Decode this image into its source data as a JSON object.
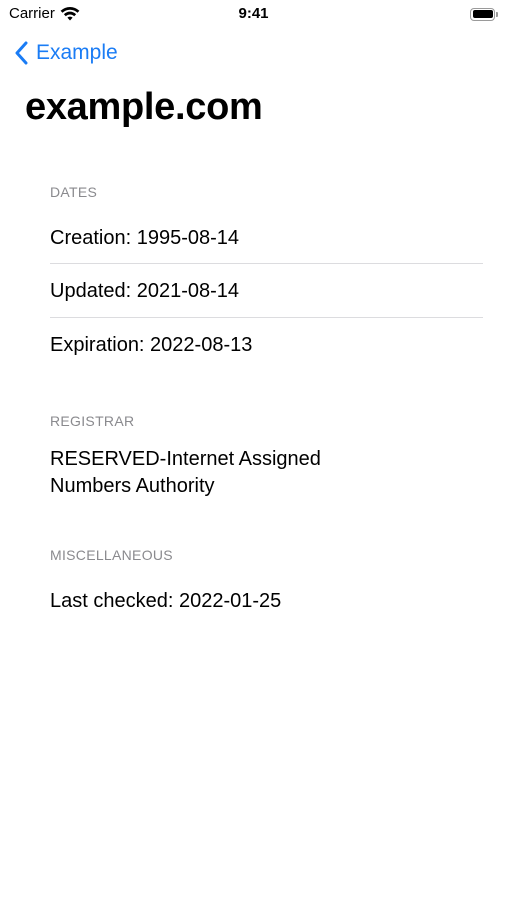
{
  "status_bar": {
    "carrier": "Carrier",
    "time": "9:41"
  },
  "nav": {
    "back_label": "Example",
    "title": "example.com"
  },
  "sections": {
    "dates": {
      "header": "DATES",
      "rows": [
        "Creation: 1995-08-14",
        "Updated: 2021-08-14",
        "Expiration: 2022-08-13"
      ]
    },
    "registrar": {
      "header": "REGISTRAR",
      "line1": "RESERVED-Internet Assigned",
      "line2": "Numbers Authority"
    },
    "miscellaneous": {
      "header": "MISCELLANEOUS",
      "rows": [
        "Last checked: 2022-01-25"
      ]
    }
  },
  "colors": {
    "accent": "#1a7cf5",
    "secondary_text": "#8a8a8e",
    "separator": "#dcdcdf"
  }
}
